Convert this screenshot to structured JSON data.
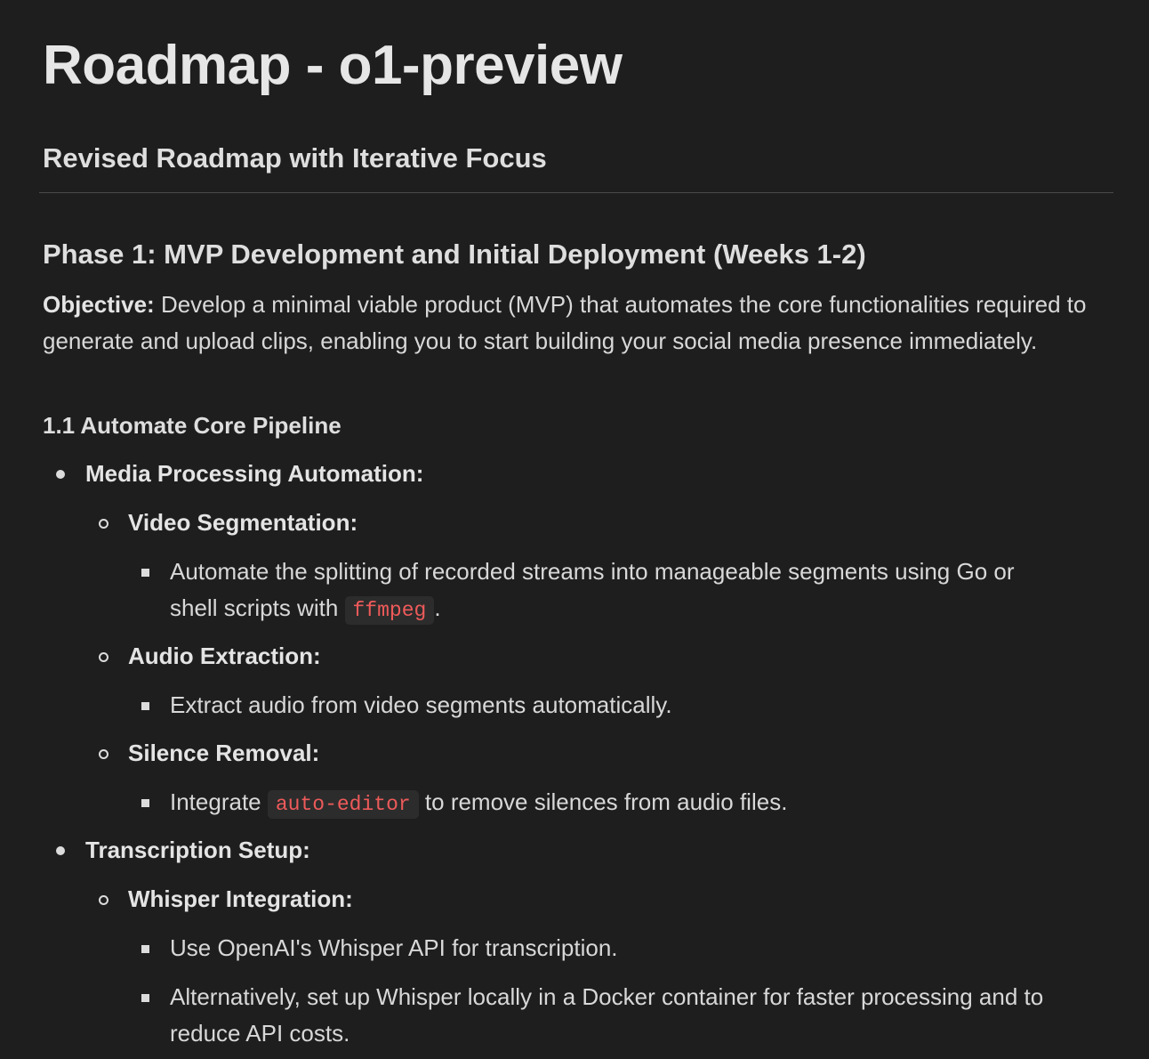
{
  "title": "Roadmap - o1-preview",
  "subtitle": "Revised Roadmap with Iterative Focus",
  "phase1": {
    "heading": "Phase 1: MVP Development and Initial Deployment (Weeks 1-2)",
    "objective_label": "Objective:",
    "objective_text": " Develop a minimal viable product (MVP) that automates the core functionalities required to generate and upload clips, enabling you to start building your social media presence immediately.",
    "section_1_1": {
      "heading": "1.1 Automate Core Pipeline",
      "media": {
        "label": "Media Processing Automation:",
        "video_segmentation": {
          "label": "Video Segmentation:",
          "item_before": "Automate the splitting of recorded streams into manageable segments using Go or",
          "item_line2_before": "shell scripts with ",
          "item_code": "ffmpeg",
          "item_after": "."
        },
        "audio_extraction": {
          "label": "Audio Extraction:",
          "item": "Extract audio from video segments automatically."
        },
        "silence_removal": {
          "label": "Silence Removal:",
          "item_before": "Integrate ",
          "item_code": "auto-editor",
          "item_after": " to remove silences from audio files."
        }
      },
      "transcription": {
        "label": "Transcription Setup:",
        "whisper": {
          "label": "Whisper Integration:",
          "item1": "Use OpenAI's Whisper API for transcription.",
          "item2_line1": "Alternatively, set up Whisper locally in a Docker container for faster processing and to",
          "item2_line2": "reduce API costs."
        }
      }
    }
  }
}
